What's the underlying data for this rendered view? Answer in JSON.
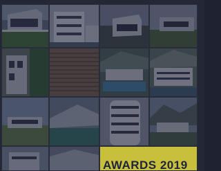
{
  "banner": {
    "awards_label": "AWARDS 2019"
  },
  "colors": {
    "overlay": "#121630",
    "awards_background": "#c8bf3a",
    "awards_text": "#1d2340"
  },
  "tiles": [
    "modern-house-with-lawn",
    "white-apartment-block",
    "hillside-villa",
    "concrete-residence",
    "facade-with-greenery",
    "timber-slat-facade",
    "mountain-resort-pool",
    "riverside-apartments",
    "low-house-in-meadow",
    "sloped-roof-pavilion",
    "curved-office-tower",
    "mountain-valley-house",
    "partial-building",
    "partial-house"
  ]
}
